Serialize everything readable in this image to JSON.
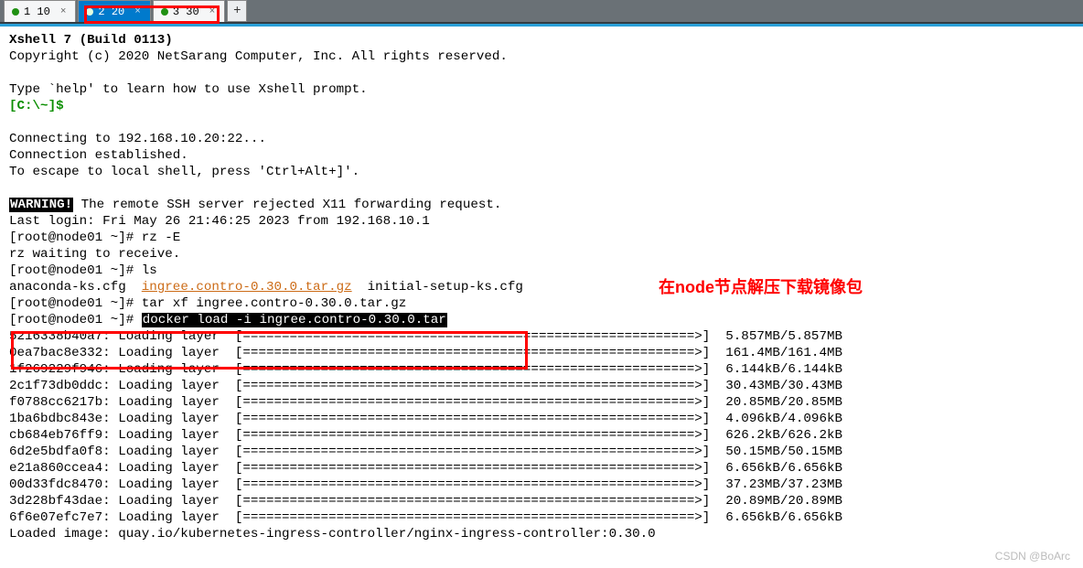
{
  "tabs": [
    {
      "dot": true,
      "label": "1 10",
      "active": false,
      "closeable": true
    },
    {
      "dot": true,
      "label": "2 20",
      "active": true,
      "closeable": true
    },
    {
      "dot": true,
      "label": "3 30",
      "active": false,
      "closeable": true
    }
  ],
  "tab_add_label": "+",
  "annotation_red": "在node节点解压下载镜像包",
  "watermark": "CSDN @BoArc",
  "term": {
    "title": "Xshell 7 (Build 0113)",
    "copyright": "Copyright (c) 2020 NetSarang Computer, Inc. All rights reserved.",
    "help_line": "Type `help' to learn how to use Xshell prompt.",
    "prompt_local": "[C:\\~]$",
    "connecting": "Connecting to 192.168.10.20:22...",
    "established": "Connection established.",
    "escape": "To escape to local shell, press 'Ctrl+Alt+]'.",
    "warning_label": "WARNING!",
    "warning_rest": " The remote SSH server rejected X11 forwarding request.",
    "last_login": "Last login: Fri May 26 21:46:25 2023 from 192.168.10.1",
    "p1": "[root@node01 ~]# ",
    "cmd_rz": "rz -E",
    "rz_wait": "rz waiting to receive.",
    "cmd_ls": "ls",
    "ls_out_a": "anaconda-ks.cfg  ",
    "ls_out_b": "ingree.contro-0.30.0.tar.gz",
    "ls_out_c": "  initial-setup-ks.cfg",
    "cmd_tar": "tar xf ingree.contro-0.30.0.tar.gz",
    "cmd_docker": "docker load -i ingree.contro-0.30.0.tar",
    "layers": [
      {
        "hash": "5216338b40a7",
        "bar": "[==========================================================>]",
        "size": "5.857MB/5.857MB"
      },
      {
        "hash": "0ea7bac8e332",
        "bar": "[==========================================================>]",
        "size": "161.4MB/161.4MB"
      },
      {
        "hash": "1f269229f946",
        "bar": "[==========================================================>]",
        "size": "6.144kB/6.144kB"
      },
      {
        "hash": "2c1f73db0ddc",
        "bar": "[==========================================================>]",
        "size": "30.43MB/30.43MB"
      },
      {
        "hash": "f0788cc6217b",
        "bar": "[==========================================================>]",
        "size": "20.85MB/20.85MB"
      },
      {
        "hash": "1ba6bdbc843e",
        "bar": "[==========================================================>]",
        "size": "4.096kB/4.096kB"
      },
      {
        "hash": "cb684eb76ff9",
        "bar": "[==========================================================>]",
        "size": "626.2kB/626.2kB"
      },
      {
        "hash": "6d2e5bdfa0f8",
        "bar": "[==========================================================>]",
        "size": "50.15MB/50.15MB"
      },
      {
        "hash": "e21a860ccea4",
        "bar": "[==========================================================>]",
        "size": "6.656kB/6.656kB"
      },
      {
        "hash": "00d33fdc8470",
        "bar": "[==========================================================>]",
        "size": "37.23MB/37.23MB"
      },
      {
        "hash": "3d228bf43dae",
        "bar": "[==========================================================>]",
        "size": "20.89MB/20.89MB"
      },
      {
        "hash": "6f6e07efc7e7",
        "bar": "[==========================================================>]",
        "size": "6.656kB/6.656kB"
      }
    ],
    "loading_label": ": Loading layer  ",
    "loaded_image": "Loaded image: quay.io/kubernetes-ingress-controller/nginx-ingress-controller:0.30.0"
  }
}
